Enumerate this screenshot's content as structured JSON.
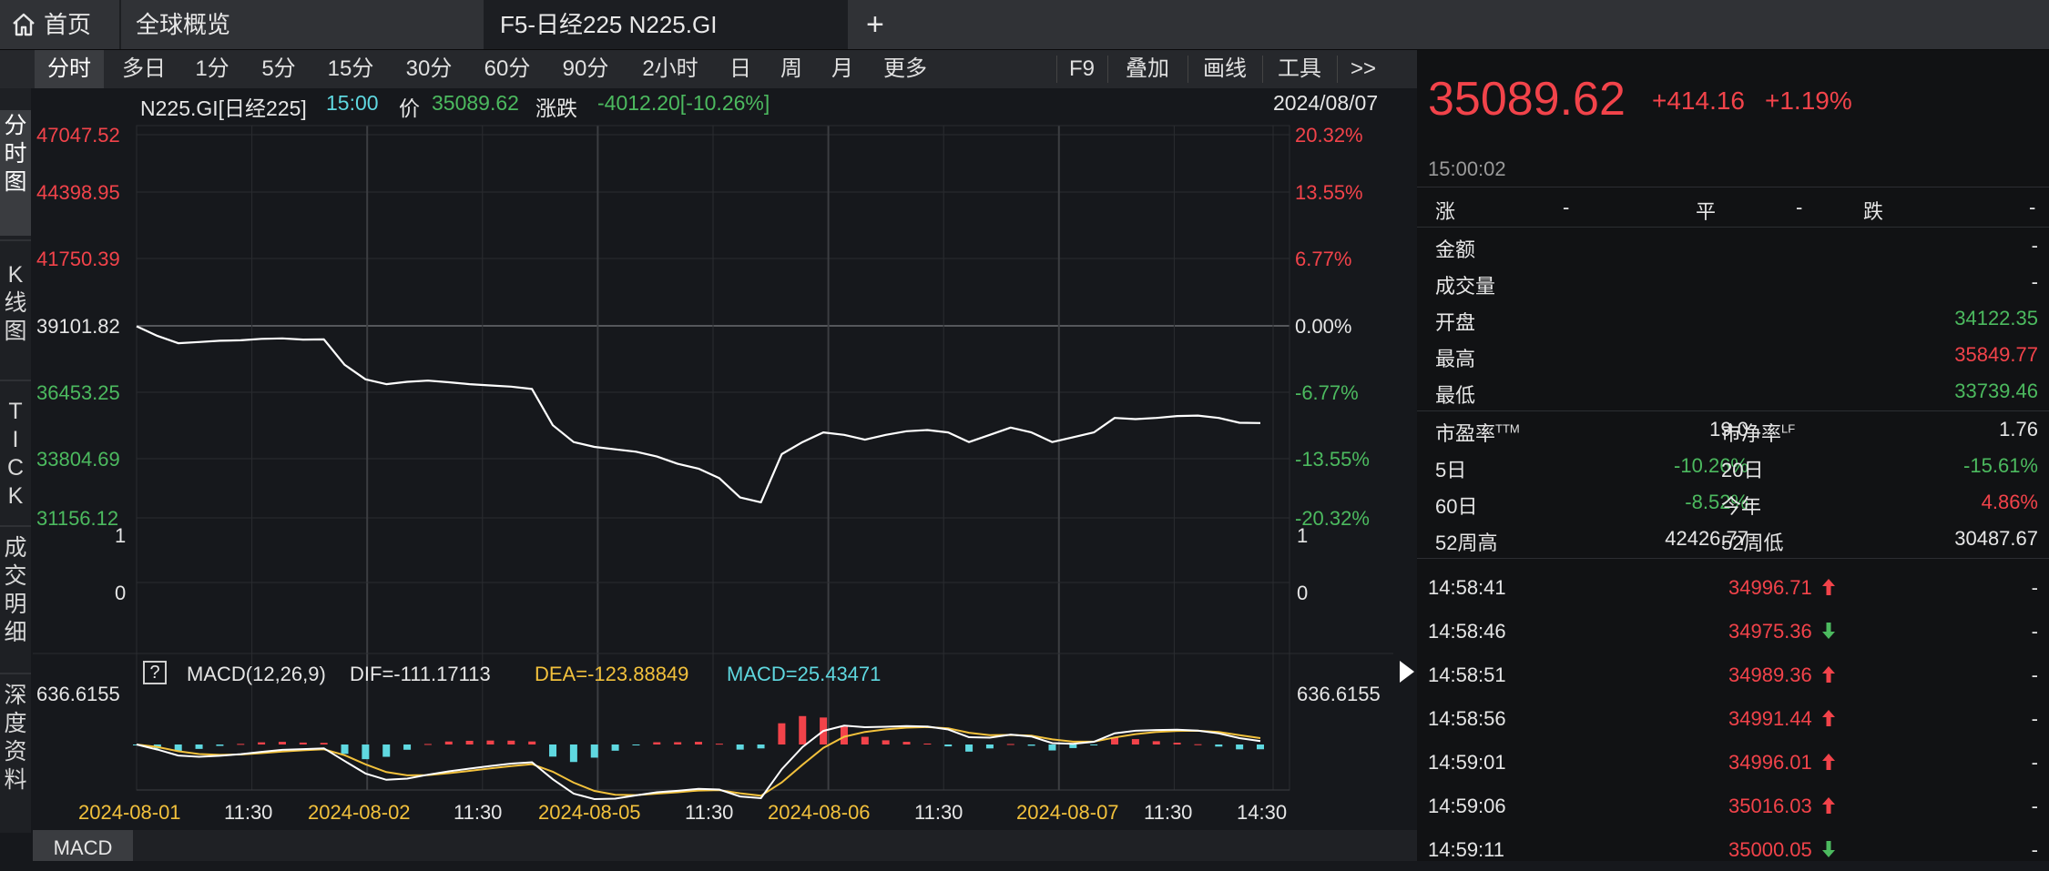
{
  "tabs": {
    "home_label": "首页",
    "overview_label": "全球概览",
    "active_label": "F5-日经225 N225.GI",
    "add_label": "+"
  },
  "toolbar": {
    "periods": [
      "分时",
      "多日",
      "1分",
      "5分",
      "15分",
      "30分",
      "60分",
      "90分",
      "2小时",
      "日",
      "周",
      "月",
      "更多"
    ],
    "tools": [
      "F9",
      "叠加",
      "画线",
      "工具",
      ">>"
    ]
  },
  "left_tabs": [
    "分时图",
    "K线图",
    "TICK",
    "成交明细",
    "深度资料"
  ],
  "chart": {
    "name": "N225.GI[日经225]",
    "time": "15:00",
    "price_label": "价",
    "price": "35089.62",
    "change_label": "涨跌",
    "change": "-4012.20[-10.26%]",
    "date": "2024/08/07",
    "price_ticks": [
      "47047.52",
      "44398.95",
      "41750.39",
      "39101.82",
      "36453.25",
      "33804.69",
      "31156.12"
    ],
    "pct_ticks": [
      "20.32%",
      "13.55%",
      "6.77%",
      "0.00%",
      "-6.77%",
      "-13.55%",
      "-20.32%"
    ],
    "vol_ticks": [
      "1",
      "0"
    ],
    "macd_help": "?",
    "macd_title": "MACD(12,26,9)",
    "macd_dif": "DIF=-111.17113",
    "macd_dea": "DEA=-123.88849",
    "macd_val": "MACD=25.43471",
    "macd_top": "636.6155",
    "x_labels": [
      "2024-08-01",
      "11:30",
      "2024-08-02",
      "11:30",
      "2024-08-05",
      "11:30",
      "2024-08-06",
      "11:30",
      "2024-08-07",
      "11:30",
      "14:30"
    ],
    "bottom_tab": "MACD"
  },
  "chart_data": {
    "type": "line",
    "x": [
      "2024-08-01",
      "2024-08-02",
      "2024-08-05",
      "2024-08-06",
      "2024-08-07"
    ],
    "ylim": [
      31156.12,
      47047.52
    ],
    "pre_close": 39101.82,
    "series": [
      {
        "values": [
          39101.82,
          38700,
          38400,
          38450,
          38500,
          38520,
          38580,
          38600,
          38550,
          38560,
          37500,
          36900,
          36700,
          36800,
          36850,
          36780,
          36700,
          36650,
          36600,
          36500,
          35000,
          34300,
          34100,
          34000,
          33900,
          33700,
          33400,
          33200,
          32800,
          32000,
          31800,
          33800,
          34300,
          34700,
          34600,
          34400,
          34600,
          34750,
          34800,
          34700,
          34300,
          34600,
          34900,
          34700,
          34300,
          34500,
          34700,
          35300,
          35250,
          35300,
          35380,
          35400,
          35300,
          35100,
          35089.62
        ]
      }
    ],
    "macd": {
      "dif": -111.17113,
      "dea": -123.88849,
      "macd": 25.43471,
      "top": 636.6155
    }
  },
  "quote": {
    "price": "35089.62",
    "change": "+414.16",
    "pct": "+1.19%",
    "time": "15:00:02"
  },
  "stats": {
    "up_label": "涨",
    "up_val": "-",
    "flat_label": "平",
    "flat_val": "-",
    "down_label": "跌",
    "down_val": "-",
    "amount_label": "金额",
    "amount_val": "-",
    "volume_label": "成交量",
    "volume_val": "-",
    "open_label": "开盘",
    "open_val": "34122.35",
    "high_label": "最高",
    "high_val": "35849.77",
    "low_label": "最低",
    "low_val": "33739.46",
    "pe_label": "市盈率",
    "pe_sup": "TTM",
    "pe_val": "19.0",
    "pb_label": "市净率",
    "pb_sup": "LF",
    "pb_val": "1.76",
    "d5_label": "5日",
    "d5_val": "-10.26%",
    "d20_label": "20日",
    "d20_val": "-15.61%",
    "d60_label": "60日",
    "d60_val": "-8.52%",
    "ytd_label": "今年",
    "ytd_val": "4.86%",
    "w52h_label": "52周高",
    "w52h_val": "42426.77",
    "w52l_label": "52周低",
    "w52l_val": "30487.67"
  },
  "ticks": [
    {
      "time": "14:58:41",
      "price": "34996.71",
      "dir": "up",
      "vol": "-"
    },
    {
      "time": "14:58:46",
      "price": "34975.36",
      "dir": "down",
      "vol": "-"
    },
    {
      "time": "14:58:51",
      "price": "34989.36",
      "dir": "up",
      "vol": "-"
    },
    {
      "time": "14:58:56",
      "price": "34991.44",
      "dir": "up",
      "vol": "-"
    },
    {
      "time": "14:59:01",
      "price": "34996.01",
      "dir": "up",
      "vol": "-"
    },
    {
      "time": "14:59:06",
      "price": "35016.03",
      "dir": "up",
      "vol": "-"
    },
    {
      "time": "14:59:11",
      "price": "35000.05",
      "dir": "down",
      "vol": "-"
    }
  ],
  "colors": {
    "up": "#f2434a",
    "down": "#4cba5f",
    "accent_yellow": "#f2c13c",
    "teal": "#5fd8e0"
  }
}
